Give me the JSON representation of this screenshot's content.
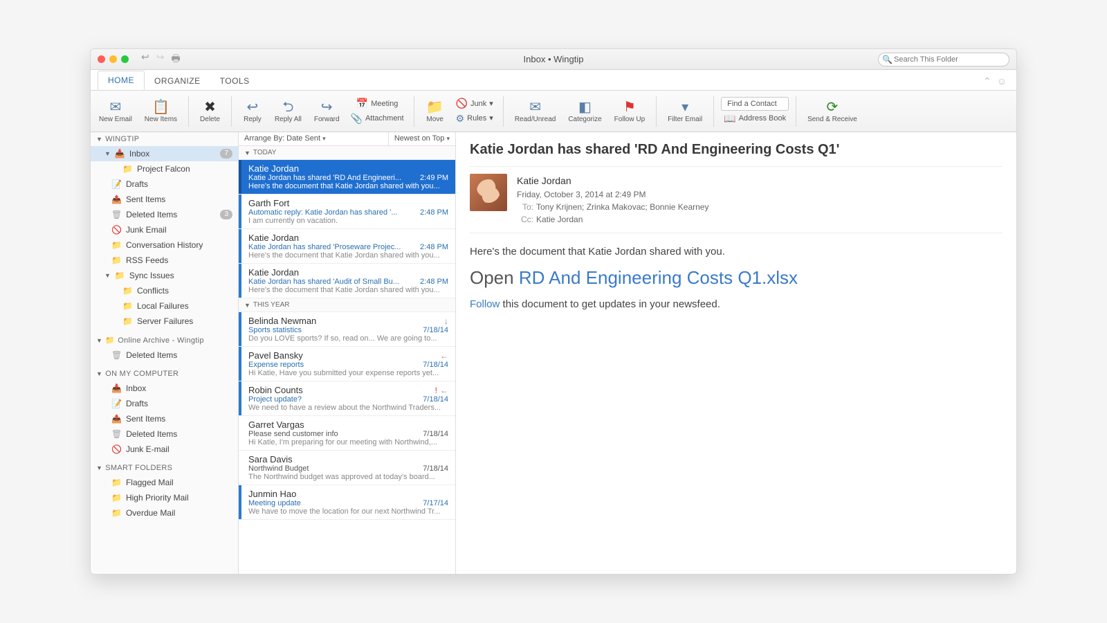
{
  "title": "Inbox • Wingtip",
  "search_placeholder": "Search This Folder",
  "tabs": [
    "HOME",
    "ORGANIZE",
    "TOOLS"
  ],
  "ribbon": {
    "new_email": "New Email",
    "new_items": "New Items",
    "delete": "Delete",
    "reply": "Reply",
    "reply_all": "Reply All",
    "forward": "Forward",
    "meeting": "Meeting",
    "attachment": "Attachment",
    "move": "Move",
    "junk": "Junk",
    "rules": "Rules",
    "read_unread": "Read/Unread",
    "categorize": "Categorize",
    "follow_up": "Follow Up",
    "filter": "Filter Email",
    "find_contact": "Find a Contact",
    "address_book": "Address Book",
    "send_receive": "Send & Receive"
  },
  "sidebar": {
    "acct": "WINGTIP",
    "inbox": {
      "label": "Inbox",
      "count": "7"
    },
    "project": "Project Falcon",
    "drafts": "Drafts",
    "sent": "Sent Items",
    "deleted": {
      "label": "Deleted Items",
      "count": "3"
    },
    "junk": "Junk Email",
    "conv": "Conversation History",
    "rss": "RSS Feeds",
    "sync": "Sync Issues",
    "conflicts": "Conflicts",
    "local_fail": "Local Failures",
    "server_fail": "Server Failures",
    "archive": "Online Archive - Wingtip",
    "arch_del": "Deleted Items",
    "onmy": "ON MY COMPUTER",
    "c_inbox": "Inbox",
    "c_drafts": "Drafts",
    "c_sent": "Sent Items",
    "c_del": "Deleted Items",
    "c_junk": "Junk E-mail",
    "smart": "SMART FOLDERS",
    "flagged": "Flagged Mail",
    "high": "High Priority Mail",
    "overdue": "Overdue Mail"
  },
  "arrange": {
    "by": "Arrange By: Date Sent",
    "sort": "Newest on Top"
  },
  "groups": {
    "today": "TODAY",
    "year": "THIS YEAR"
  },
  "messages": [
    {
      "from": "Katie Jordan",
      "subj": "Katie Jordan has shared 'RD And Engineeri...",
      "time": "2:49 PM",
      "prev": "Here's the document that Katie Jordan shared with you...",
      "sel": true,
      "bar": true
    },
    {
      "from": "Garth Fort",
      "subj": "Automatic reply: Katie Jordan has shared '...",
      "time": "2:48 PM",
      "prev": "I am currently on vacation.",
      "bar": true
    },
    {
      "from": "Katie Jordan",
      "subj": "Katie Jordan has shared 'Proseware Projec...",
      "time": "2:48 PM",
      "prev": "Here's the document that Katie Jordan shared with you...",
      "bar": true
    },
    {
      "from": "Katie Jordan",
      "subj": "Katie Jordan has shared 'Audit of Small Bu...",
      "time": "2:48 PM",
      "prev": "Here's the document that Katie Jordan shared with you...",
      "bar": true
    }
  ],
  "year_messages": [
    {
      "from": "Belinda Newman",
      "subj": "Sports statistics",
      "time": "7/18/14",
      "prev": "Do you LOVE sports? If so, read on... We are going to...",
      "bar": true,
      "meta": "↓"
    },
    {
      "from": "Pavel Bansky",
      "subj": "Expense reports",
      "time": "7/18/14",
      "prev": "Hi Katie, Have you submitted your expense reports yet...",
      "bar": true,
      "meta": "←"
    },
    {
      "from": "Robin Counts",
      "subj": "Project update?",
      "time": "7/18/14",
      "prev": "We need to have a review about the Northwind Traders...",
      "bar": true,
      "meta": "! ←",
      "important": true
    },
    {
      "from": "Garret Vargas",
      "subj": "Please send customer info",
      "time": "7/18/14",
      "prev": "Hi Katie, I'm preparing for our meeting with Northwind,...",
      "bar": false
    },
    {
      "from": "Sara Davis",
      "subj": "Northwind Budget",
      "time": "7/18/14",
      "prev": "The Northwind budget was approved at today's board...",
      "bar": false
    },
    {
      "from": "Junmin Hao",
      "subj": "Meeting update",
      "time": "7/17/14",
      "prev": "We have to move the location for our next Northwind Tr...",
      "bar": true
    }
  ],
  "reader": {
    "title": "Katie Jordan has shared 'RD And Engineering Costs Q1'",
    "from": "Katie Jordan",
    "date": "Friday, October 3, 2014 at 2:49 PM",
    "to_label": "To:",
    "to": "Tony Krijnen;   Zrinka Makovac;   Bonnie Kearney",
    "cc_label": "Cc:",
    "cc": "Katie Jordan",
    "line1": "Here's the document that Katie Jordan shared with you.",
    "open_word": "Open ",
    "open_link": "RD And Engineering Costs Q1.xlsx",
    "follow_link": "Follow",
    "follow_rest": " this document to get updates in your newsfeed."
  }
}
